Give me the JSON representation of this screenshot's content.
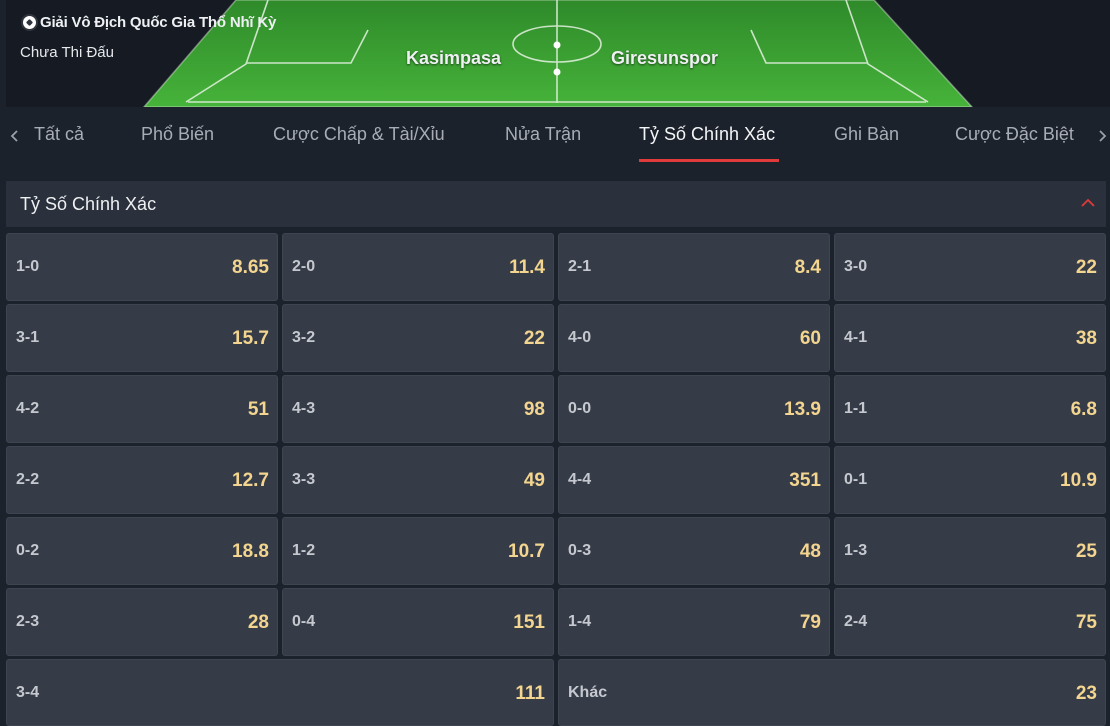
{
  "match": {
    "league": "Giải Vô Địch Quốc Gia Thổ Nhĩ Kỳ",
    "status": "Chưa Thi Đấu",
    "home": "Kasimpasa",
    "away": "Giresunspor"
  },
  "tabs": [
    {
      "label": "Tất cả"
    },
    {
      "label": "Phổ Biến"
    },
    {
      "label": "Cược Chấp & Tài/Xỉu"
    },
    {
      "label": "Nửa Trận"
    },
    {
      "label": "Tỷ Số Chính Xác",
      "active": true
    },
    {
      "label": "Ghi Bàn"
    },
    {
      "label": "Cược Đặc Biệt"
    }
  ],
  "section": {
    "title": "Tỷ Số Chính Xác"
  },
  "odds": [
    {
      "score": "1-0",
      "odds": "8.65"
    },
    {
      "score": "2-0",
      "odds": "11.4"
    },
    {
      "score": "2-1",
      "odds": "8.4"
    },
    {
      "score": "3-0",
      "odds": "22"
    },
    {
      "score": "3-1",
      "odds": "15.7"
    },
    {
      "score": "3-2",
      "odds": "22"
    },
    {
      "score": "4-0",
      "odds": "60"
    },
    {
      "score": "4-1",
      "odds": "38"
    },
    {
      "score": "4-2",
      "odds": "51"
    },
    {
      "score": "4-3",
      "odds": "98"
    },
    {
      "score": "0-0",
      "odds": "13.9"
    },
    {
      "score": "1-1",
      "odds": "6.8"
    },
    {
      "score": "2-2",
      "odds": "12.7"
    },
    {
      "score": "3-3",
      "odds": "49"
    },
    {
      "score": "4-4",
      "odds": "351"
    },
    {
      "score": "0-1",
      "odds": "10.9"
    },
    {
      "score": "0-2",
      "odds": "18.8"
    },
    {
      "score": "1-2",
      "odds": "10.7"
    },
    {
      "score": "0-3",
      "odds": "48"
    },
    {
      "score": "1-3",
      "odds": "25"
    },
    {
      "score": "2-3",
      "odds": "28"
    },
    {
      "score": "0-4",
      "odds": "151"
    },
    {
      "score": "1-4",
      "odds": "79"
    },
    {
      "score": "2-4",
      "odds": "75"
    },
    {
      "score": "3-4",
      "odds": "111"
    },
    {
      "score": "Khác",
      "odds": "23"
    }
  ],
  "colors": {
    "accent": "#e03a3a",
    "odds": "#f3d58f",
    "pitch": "#3fa535"
  },
  "icons": {
    "league": "soccer-ball-icon",
    "tab_prev": "chevron-left-icon",
    "tab_next": "chevron-right-icon",
    "collapse": "chevron-up-icon"
  }
}
